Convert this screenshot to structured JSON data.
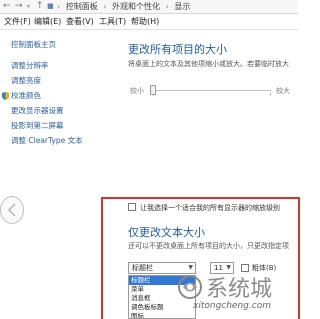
{
  "addressbar": {
    "back": "←",
    "forward": "→",
    "up": "↑",
    "crumbs": [
      "控制面板",
      "外观和个性化",
      "显示"
    ],
    "separator": "›"
  },
  "menubar": {
    "items": [
      "文件(F)",
      "编辑(E)",
      "查看(V)",
      "工具(T)",
      "帮助(H)"
    ]
  },
  "sidebar": {
    "home": "控制面板主页",
    "links": [
      "调整分辨率",
      "调整亮度",
      "校准颜色",
      "更改显示器设置",
      "投影到第二屏幕",
      "调整 ClearType 文本"
    ]
  },
  "size_section": {
    "title": "更改所有项目的大小",
    "description": "将桌面上的文本及其他项缩小或放大。若要临时放大",
    "slider_min": "较小",
    "slider_max": "较大"
  },
  "scaling_checkbox": {
    "label": "让我选择一个适合我的所有显示器的缩放级别"
  },
  "text_section": {
    "title": "仅更改文本大小",
    "description": "还可以不更改桌面上所有项目的大小，只更改指定项",
    "item_select": "标题栏",
    "size_select": "11",
    "bold_label": "粗体(B)",
    "options": [
      "标题栏",
      "菜单",
      "消息框",
      "调色板标题",
      "图标"
    ]
  },
  "watermark": {
    "brand": "系统城",
    "url": "xitongcheng.com"
  },
  "colors": {
    "accent_blue": "#1f5fa8",
    "highlight_red": "#d8322b",
    "selected_option": "#3277d1"
  }
}
